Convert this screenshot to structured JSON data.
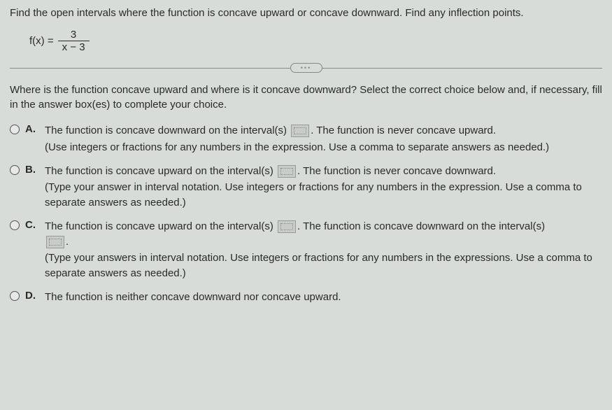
{
  "question": "Find the open intervals where the function is concave upward or concave downward. Find any inflection points.",
  "formula": {
    "lhs": "f(x) =",
    "numerator": "3",
    "denominator": "x − 3"
  },
  "pill": "•••",
  "sub_question": "Where is the function concave upward and where is it concave downward? Select the correct choice below and, if necessary, fill in the answer box(es) to complete your choice.",
  "choices": {
    "a": {
      "letter": "A.",
      "pre": "The function is concave downward on the interval(s) ",
      "post": ". The function is never concave upward.",
      "hint": "(Use integers or fractions for any numbers in the expression. Use a comma to separate answers as needed.)"
    },
    "b": {
      "letter": "B.",
      "pre": "The function is concave upward on the interval(s) ",
      "post": ". The function is never concave downward.",
      "hint": "(Type your answer in interval notation. Use integers or fractions for any numbers in the expression. Use a comma to separate answers as needed.)"
    },
    "c": {
      "letter": "C.",
      "pre": "The function is concave upward on the interval(s) ",
      "mid": ". The function is concave downward on the interval(s) ",
      "post": ".",
      "hint": "(Type your answers in interval notation. Use integers or fractions for any numbers in the expressions. Use a comma to separate answers as needed.)"
    },
    "d": {
      "letter": "D.",
      "text": "The function is neither concave downward nor concave upward."
    }
  }
}
